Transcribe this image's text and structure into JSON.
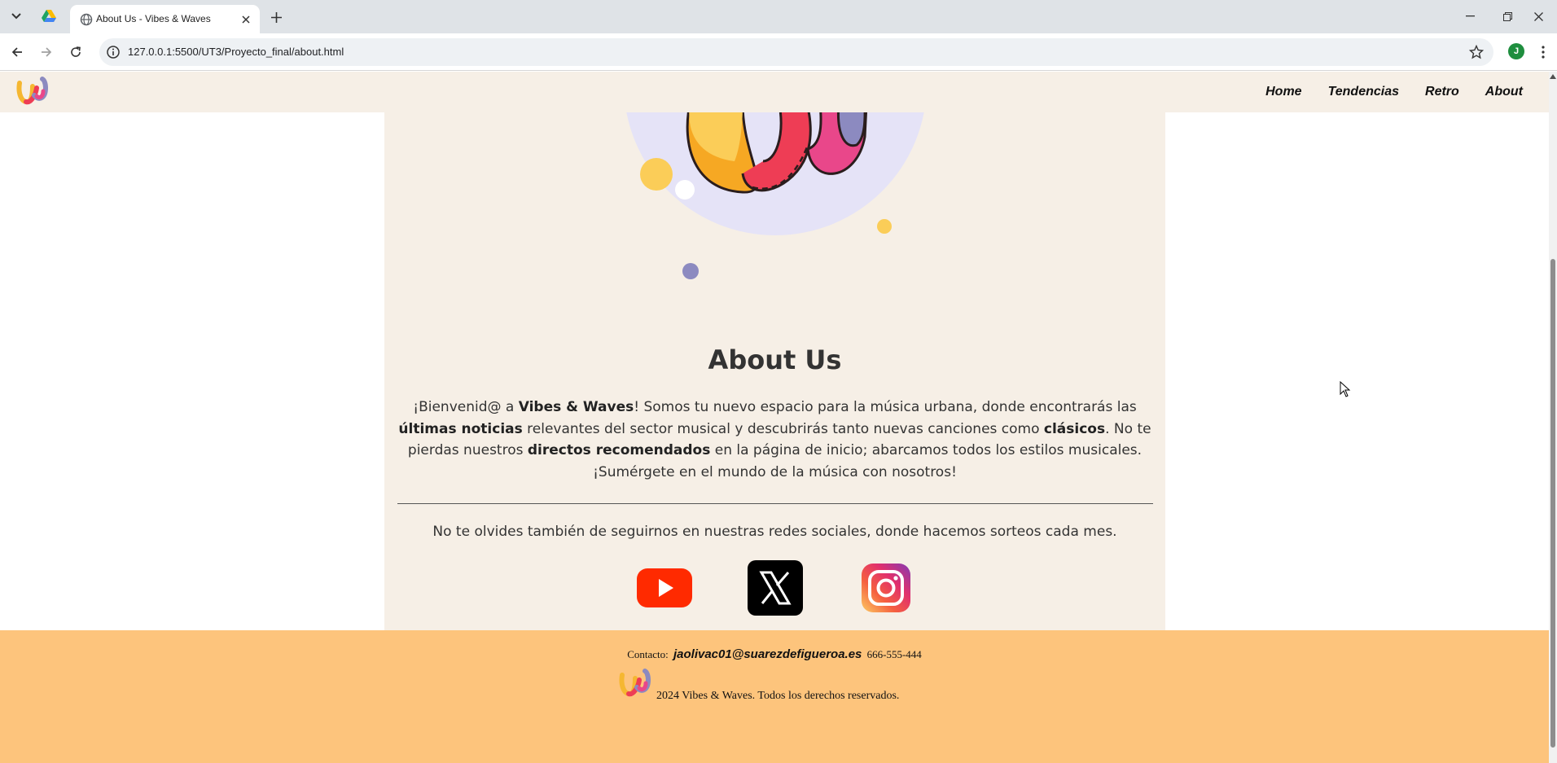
{
  "browser": {
    "tab_title": "About Us - Vibes & Waves",
    "url": "127.0.0.1:5500/UT3/Proyecto_final/about.html",
    "profile_initial": "J"
  },
  "site": {
    "nav": [
      "Home",
      "Tendencias",
      "Retro",
      "About"
    ],
    "colors": {
      "header_bg": "#f6efe6",
      "footer_bg": "#fdc47c",
      "hero_circle": "#e5e3f7",
      "youtube": "#ff2a00",
      "instagram_start": "#fccc63",
      "instagram_end": "#833ab4"
    }
  },
  "about": {
    "title": "About Us",
    "intro": {
      "t1": "¡Bienvenid@ a ",
      "b1": "Vibes & Waves",
      "t2": "! Somos tu nuevo espacio para la música urbana, donde encontrarás las ",
      "b2": "últimas noticias",
      "t3": " relevantes del sector musical y descubrirás tanto nuevas canciones como ",
      "b3": "clásicos",
      "t4": ". No te pierdas nuestros ",
      "b4": "directos recomendados",
      "t5": " en la página de inicio; abarcamos todos los estilos musicales. ¡Sumérgete en el mundo de la música con nosotros!"
    },
    "follow_text": "No te olvides también de seguirnos en nuestras redes sociales, donde hacemos sorteos cada mes.",
    "social": [
      "youtube-icon",
      "x-icon",
      "instagram-icon"
    ]
  },
  "footer": {
    "contact_label": "Contacto:",
    "email": "jaolivac01@suarezdefigueroa.es",
    "phone": "666-555-444",
    "copyright": "2024 Vibes & Waves. Todos los derechos reservados."
  }
}
